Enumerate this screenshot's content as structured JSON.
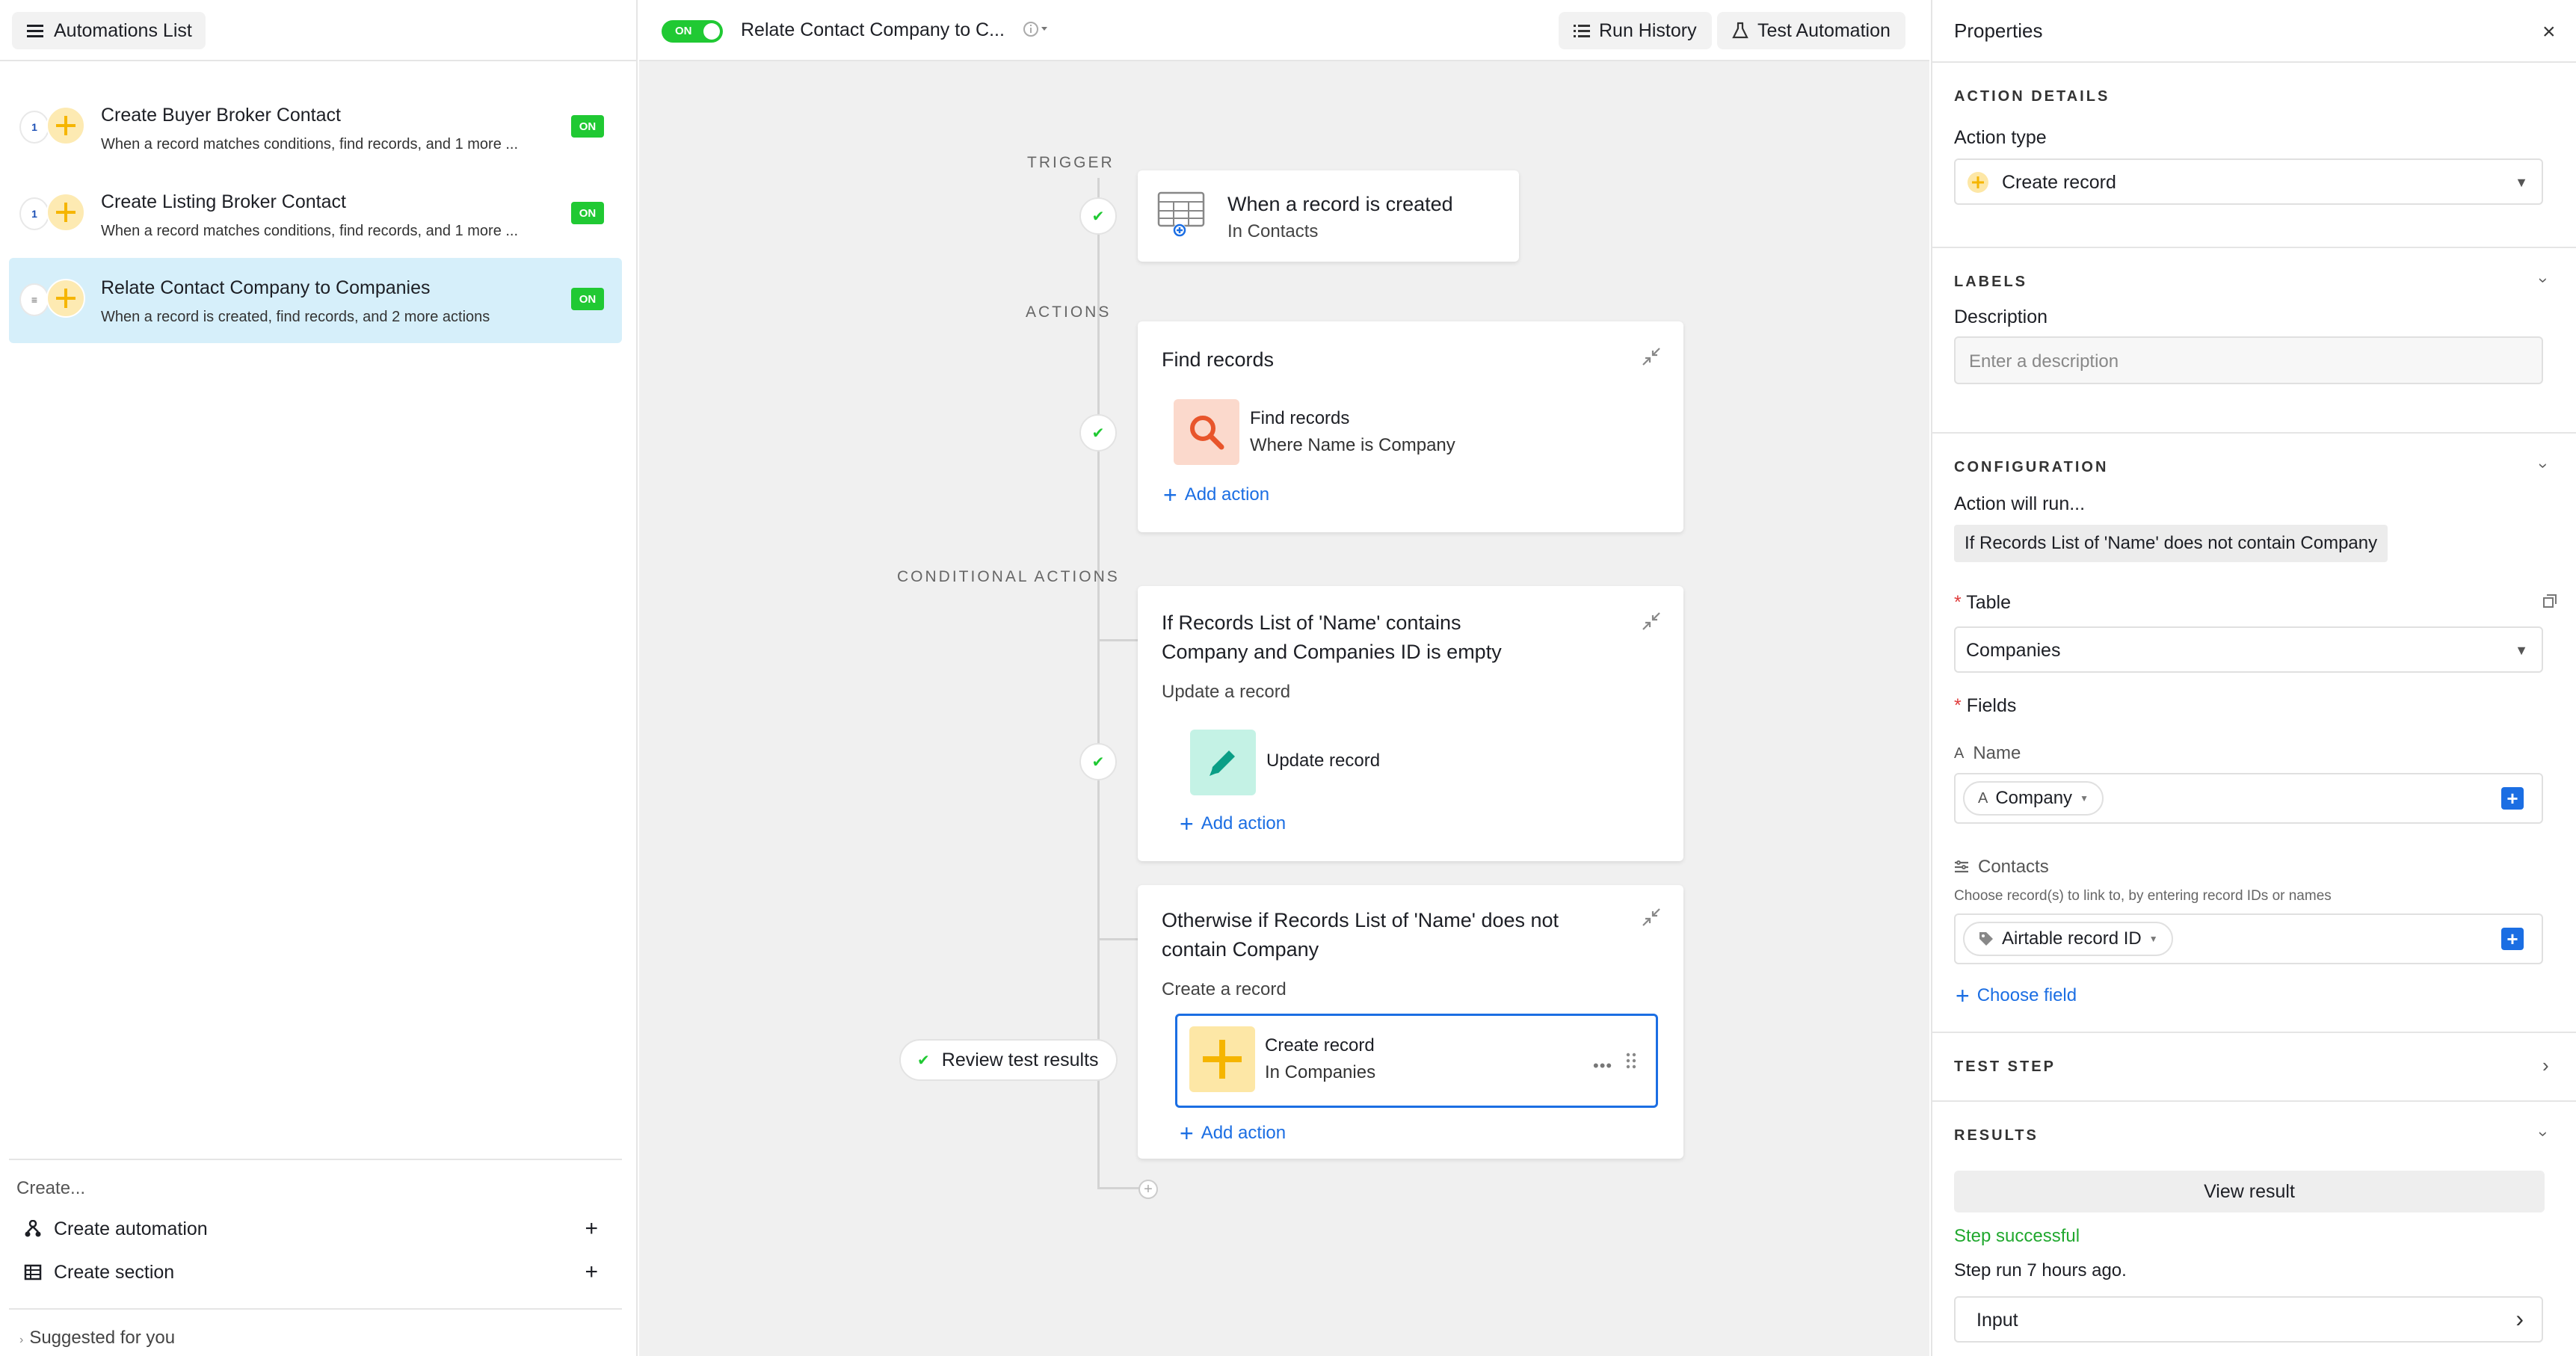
{
  "sidebar": {
    "list_button": "Automations List",
    "items": [
      {
        "title": "Create Buyer Broker Contact",
        "subtitle": "When a record matches conditions, find records, and 1 more ...",
        "status": "ON",
        "small_icon": "1"
      },
      {
        "title": "Create Listing Broker Contact",
        "subtitle": "When a record matches conditions, find records, and 1 more ...",
        "status": "ON",
        "small_icon": "1"
      },
      {
        "title": "Relate Contact Company to Companies",
        "subtitle": "When a record is created, find records, and 2 more actions",
        "status": "ON",
        "small_icon": "≡"
      }
    ],
    "create_label": "Create...",
    "create_automation": "Create automation",
    "create_section": "Create section",
    "suggested": "Suggested for you"
  },
  "header": {
    "toggle_label": "ON",
    "title": "Relate Contact Company to C...",
    "run_history": "Run History",
    "test_automation": "Test Automation"
  },
  "flow": {
    "trigger_label": "TRIGGER",
    "actions_label": "ACTIONS",
    "conditional_label": "CONDITIONAL ACTIONS",
    "trigger": {
      "title": "When a record is created",
      "subtitle": "In Contacts"
    },
    "find": {
      "card_title": "Find records",
      "item_title": "Find records",
      "item_sub": "Where Name is Company",
      "add_action": "Add action"
    },
    "cond1": {
      "title_line1": "If Records List of 'Name' contains",
      "title_line2": "Company and Companies ID is empty",
      "subtitle": "Update a record",
      "item_title": "Update record",
      "add_action": "Add action"
    },
    "cond2": {
      "title_line1": "Otherwise if Records List of 'Name' does not",
      "title_line2": "contain Company",
      "subtitle": "Create a record",
      "item_title": "Create record",
      "item_sub": "In Companies",
      "add_action": "Add action"
    },
    "review": "Review test results"
  },
  "properties": {
    "title": "Properties",
    "action_details": "ACTION DETAILS",
    "action_type_label": "Action type",
    "action_type_value": "Create record",
    "labels": "LABELS",
    "description_label": "Description",
    "description_placeholder": "Enter a description",
    "configuration": "CONFIGURATION",
    "action_will_run": "Action will run...",
    "condition_chip": "If Records List of 'Name' does not contain Company",
    "table_label": "Table",
    "table_value": "Companies",
    "fields_label": "Fields",
    "name_field_label": "Name",
    "name_token": "Company",
    "contacts_label": "Contacts",
    "contacts_help": "Choose record(s) to link to, by entering record IDs or names",
    "contacts_token": "Airtable record ID",
    "choose_field": "Choose field",
    "test_step": "TEST STEP",
    "results": "RESULTS",
    "view_result": "View result",
    "step_successful": "Step successful",
    "step_run": "Step run 7 hours ago.",
    "input": "Input"
  },
  "colors": {
    "accent": "#1b6ee3",
    "success": "#20c933",
    "selected": "#d6effa"
  }
}
